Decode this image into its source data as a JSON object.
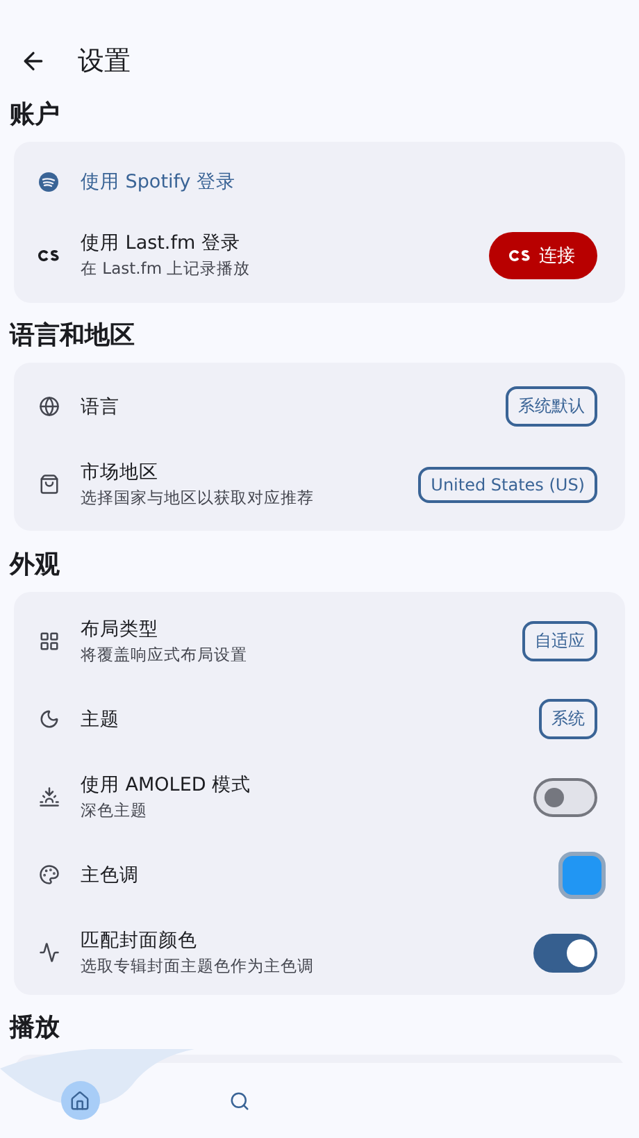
{
  "header": {
    "title": "设置"
  },
  "sections": [
    {
      "title": "账户",
      "items": [
        {
          "kind": "link",
          "title": "使用 Spotify 登录"
        },
        {
          "kind": "action",
          "title": "使用 Last.fm 登录",
          "subtitle": "在 Last.fm 上记录播放",
          "action": {
            "label": "连接"
          }
        }
      ]
    },
    {
      "title": "语言和地区",
      "items": [
        {
          "kind": "chip",
          "title": "语言",
          "value": "系统默认"
        },
        {
          "kind": "chip",
          "title": "市场地区",
          "subtitle": "选择国家与地区以获取对应推荐",
          "value": "United States (US)"
        }
      ]
    },
    {
      "title": "外观",
      "items": [
        {
          "kind": "chip",
          "title": "布局类型",
          "subtitle": "将覆盖响应式布局设置",
          "value": "自适应"
        },
        {
          "kind": "chip",
          "title": "主题",
          "value": "系统"
        },
        {
          "kind": "switch",
          "title": "使用 AMOLED 模式",
          "subtitle": "深色主题",
          "on": false
        },
        {
          "kind": "swatch",
          "title": "主色调",
          "color": "#2196f3"
        },
        {
          "kind": "switch",
          "title": "匹配封面颜色",
          "subtitle": "选取专辑封面主题色作为主色调",
          "on": true
        }
      ]
    },
    {
      "title": "播放"
    }
  ],
  "nav": [
    {
      "selected": true
    },
    {
      "selected": false
    }
  ]
}
